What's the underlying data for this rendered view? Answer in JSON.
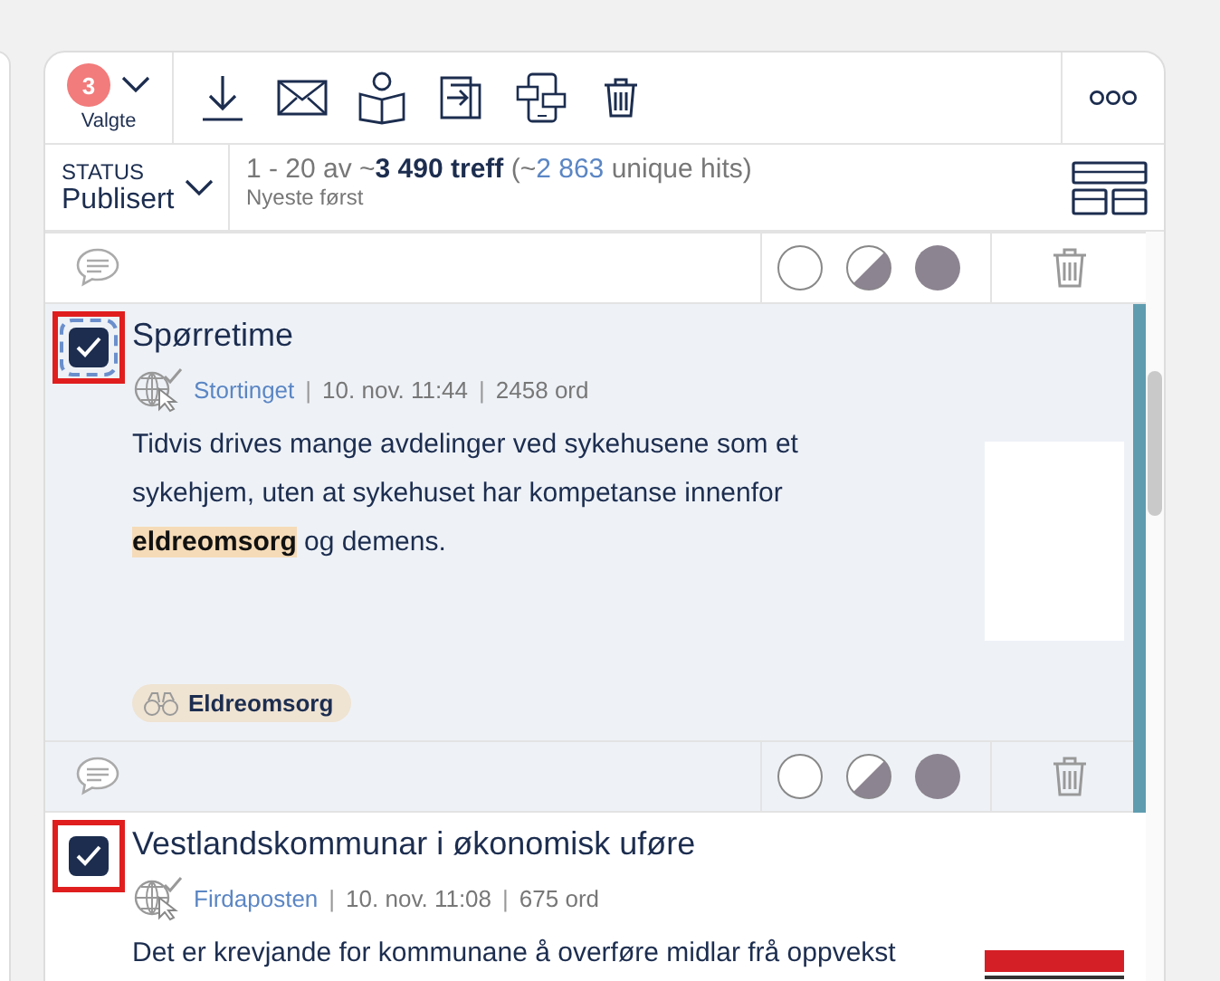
{
  "selection": {
    "count": "3",
    "label": "Valgte"
  },
  "status": {
    "label": "STATUS",
    "value": "Publisert"
  },
  "results": {
    "range": "1 - 20 av ~",
    "total": "3 490 treff",
    "open": " (~",
    "unique_count": "2 863",
    "close": " unique hits)",
    "sort": "Nyeste først"
  },
  "articles": [
    {
      "kind": "footer-only"
    },
    {
      "kind": "full",
      "checked": true,
      "focused": true,
      "marked": true,
      "active": true,
      "title": "Spørretime",
      "source": "Stortinget",
      "separator_1": "|",
      "date": "10. nov. 11:44",
      "separator_2": "|",
      "words": "2458 ord",
      "snippet": "Tidvis drives mange avdelinger ved sykehusene som et sykehjem, uten at sykehuset har kompetanse innenfor **eldreomsorg** og demens.",
      "thumbnail": {
        "kind": "blank"
      },
      "tags": [
        {
          "label": "Eldreomsorg"
        }
      ]
    },
    {
      "kind": "full",
      "checked": true,
      "focused": false,
      "marked": true,
      "active": false,
      "title": "Vestlandskommunar i økonomisk uføre",
      "source": "Firdaposten",
      "separator_1": "|",
      "date": "10. nov. 11:08",
      "separator_2": "|",
      "words": "675 ord",
      "snippet": "Det er krevjande for kommunane å overføre midlar frå oppvekst"
    }
  ]
}
